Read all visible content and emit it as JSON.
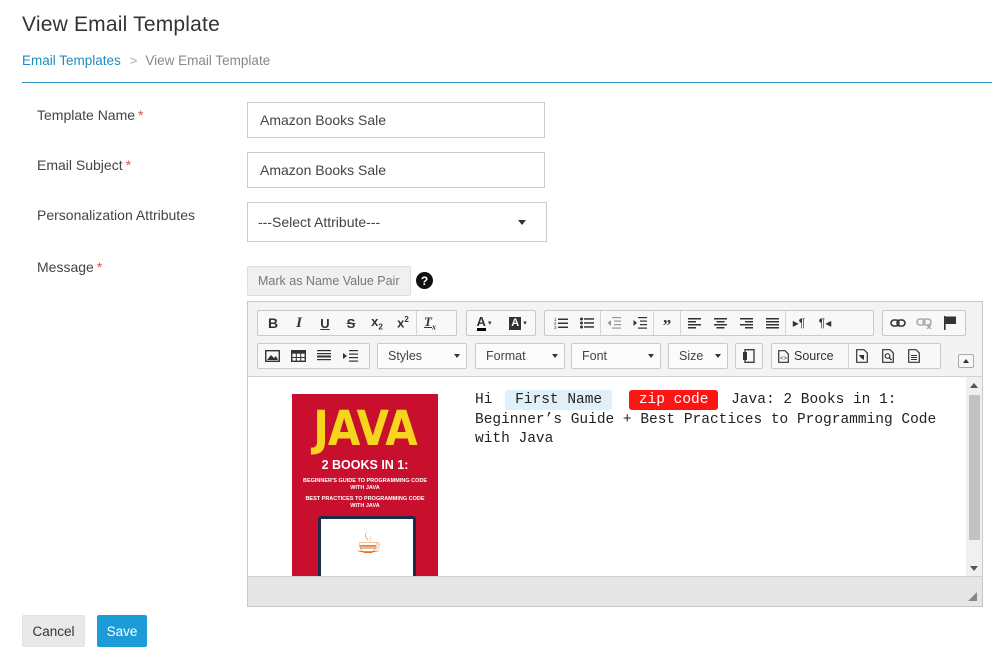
{
  "page": {
    "title": "View Email Template"
  },
  "breadcrumb": {
    "items": [
      {
        "label": "Email Templates"
      },
      {
        "label": "View Email Template"
      }
    ]
  },
  "form": {
    "template_name": {
      "label": "Template Name",
      "required": "*",
      "value": "Amazon Books Sale"
    },
    "email_subject": {
      "label": "Email Subject",
      "required": "*",
      "value": "Amazon Books Sale"
    },
    "personalization": {
      "label": "Personalization Attributes",
      "selected": "---Select Attribute---"
    },
    "message": {
      "label": "Message",
      "required": "*"
    },
    "name_value_pair_button": "Mark as Name Value Pair",
    "help_glyph": "?"
  },
  "editor": {
    "toolbar": {
      "row1_groups": [
        [
          "bold-icon",
          "italic-icon",
          "underline-icon",
          "strikethrough-icon",
          "subscript-icon",
          "superscript-icon",
          "remove-format-icon"
        ],
        [
          "text-color-icon",
          "background-color-icon"
        ],
        [
          "numbered-list-icon",
          "bulleted-list-icon",
          "decrease-indent-icon",
          "increase-indent-icon",
          "blockquote-icon",
          "align-left-icon",
          "align-center-icon",
          "align-right-icon",
          "justify-icon",
          "ltr-icon",
          "rtl-icon"
        ],
        [
          "link-icon",
          "unlink-icon",
          "anchor-icon"
        ]
      ],
      "styles_label": "Styles",
      "format_label": "Format",
      "font_label": "Font",
      "size_label": "Size",
      "source_label": "Source"
    },
    "content": {
      "image_alt": "JAVA 2 BOOKS IN 1 book cover",
      "cover_title": "JAVA",
      "cover_books": "2 BOOKS IN 1:",
      "cover_line1": "BEGINNER'S GUIDE TO PROGRAMMING CODE WITH JAVA",
      "cover_line2": "BEST PRACTICES TO PROGRAMMING CODE WITH JAVA",
      "greeting": "Hi",
      "token_first_name": "First Name",
      "token_zip_code": "zip code",
      "body_text": "Java: 2 Books in 1: Beginner’s Guide + Best Practices to Programming Code with Java"
    },
    "colors": {
      "token_first_name_bg": "#dff0fb",
      "token_zip_code_bg": "#ff1414",
      "book_cover_bg": "#c8102e",
      "book_title_color": "#f6d51f"
    }
  },
  "actions": {
    "cancel_label": "Cancel",
    "save_label": "Save"
  },
  "theme": {
    "accent": "#1d9bd7",
    "link": "#1e8cc0",
    "required": "#d9534f"
  }
}
